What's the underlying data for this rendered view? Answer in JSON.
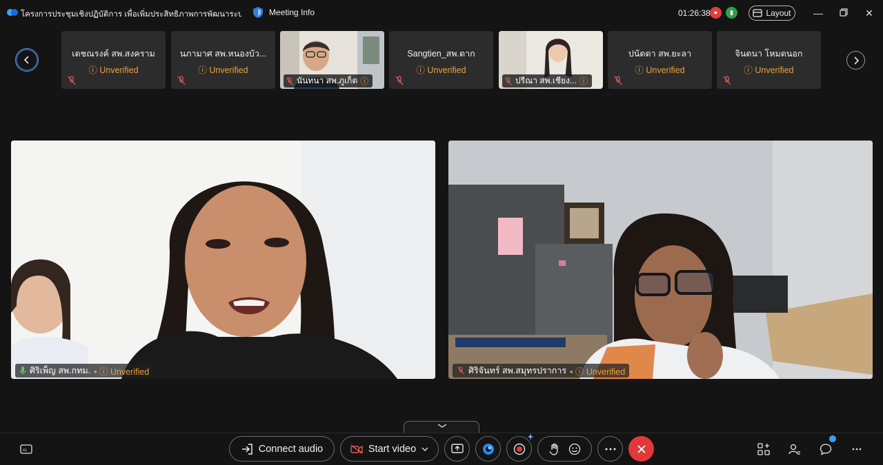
{
  "titlebar": {
    "meeting_title": "โครงการประชุมเชิงปฏิบัติการ เพื่อเพิ่มประสิทธิภาพการพัฒนาระบ...",
    "meeting_info_label": "Meeting Info",
    "timer": "01:26:38",
    "layout_label": "Layout"
  },
  "strip": {
    "tiles": [
      {
        "name": "เดชณรงค์ สพ.สงคราม",
        "status": "Unverified"
      },
      {
        "name": "นภามาศ สพ.หนองบัว...",
        "status": "Unverified"
      },
      {
        "name": "นันทนา สพ.ภูเก็ต",
        "status": ""
      },
      {
        "name": "Sangtien_สพ.ตาก",
        "status": "Unverified"
      },
      {
        "name": "ปรีณา สพ.เชียง...",
        "status": ""
      },
      {
        "name": "ปนัดดา สพ.ยะลา",
        "status": "Unverified"
      },
      {
        "name": "จินดนา โหมดนอก",
        "status": "Unverified"
      }
    ]
  },
  "stage": {
    "left": {
      "name": "ศิริเพ็ญ สพ.กทม.",
      "status": "Unverified"
    },
    "right": {
      "name": "ศิริจันทร์ สพ.สมุทรปราการ",
      "status": "Unverified"
    }
  },
  "toolbar": {
    "connect_audio_label": "Connect audio",
    "start_video_label": "Start video"
  },
  "colors": {
    "background": "#141414",
    "tile": "#2c2c2c",
    "unverified": "#e8a23a",
    "end_call": "#e2383a",
    "mute": "#e05a5a"
  }
}
